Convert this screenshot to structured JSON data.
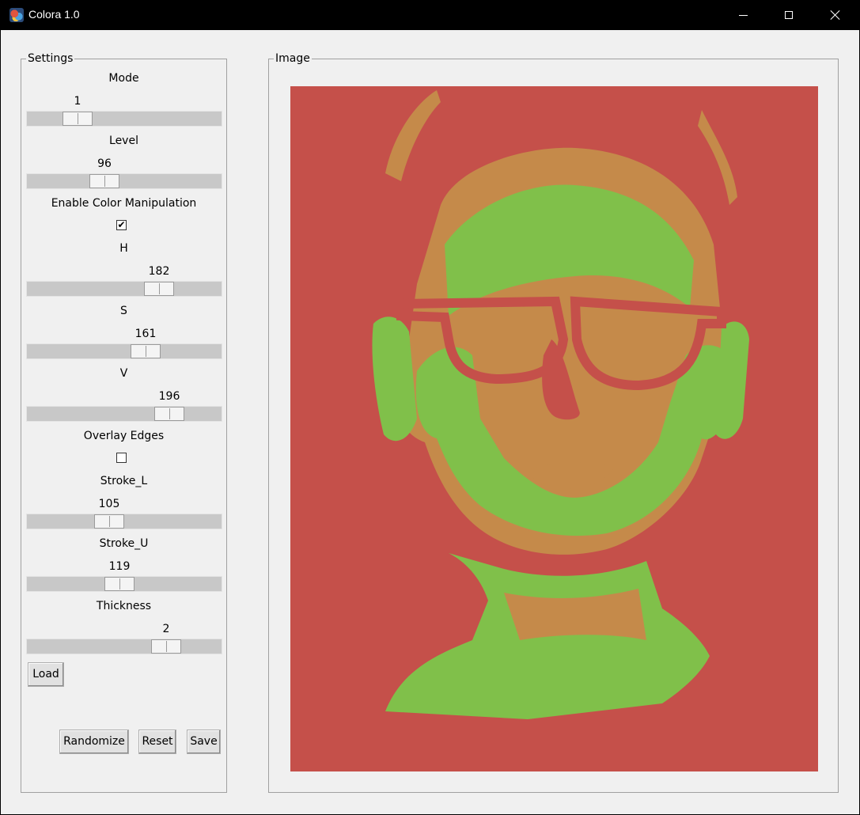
{
  "window": {
    "title": "Colora 1.0"
  },
  "settings": {
    "group_label": "Settings",
    "mode": {
      "label": "Mode",
      "value": "1",
      "fraction": 0.22
    },
    "level": {
      "label": "Level",
      "value": "96",
      "fraction": 0.38
    },
    "enable_color": {
      "label": "Enable Color Manipulation",
      "checked": true,
      "mark": "✔"
    },
    "h": {
      "label": "H",
      "value": "182",
      "fraction": 0.71
    },
    "s": {
      "label": "S",
      "value": "161",
      "fraction": 0.63
    },
    "v": {
      "label": "V",
      "value": "196",
      "fraction": 0.77
    },
    "overlay_edges": {
      "label": "Overlay Edges",
      "checked": false,
      "mark": ""
    },
    "stroke_l": {
      "label": "Stroke_L",
      "value": "105",
      "fraction": 0.41
    },
    "stroke_u": {
      "label": "Stroke_U",
      "value": "119",
      "fraction": 0.47
    },
    "thickness": {
      "label": "Thickness",
      "value": "2",
      "fraction": 0.75
    },
    "buttons": {
      "load": "Load",
      "randomize": "Randomize",
      "reset": "Reset",
      "save": "Save"
    }
  },
  "image": {
    "group_label": "Image",
    "colors": {
      "background": "#c5504a",
      "mid": "#c58a4a",
      "light": "#80c04a"
    }
  }
}
